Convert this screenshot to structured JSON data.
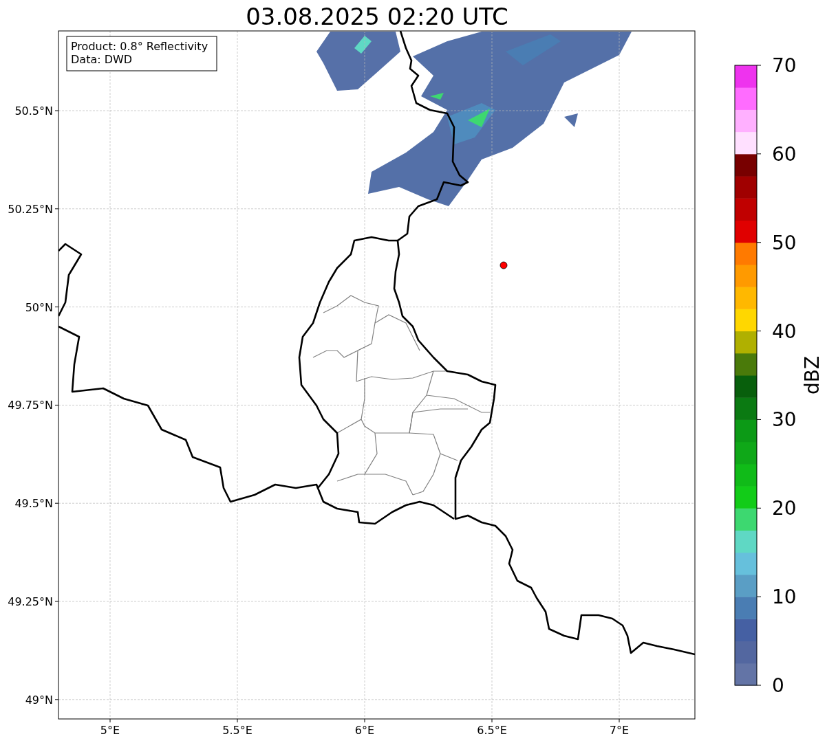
{
  "title": "03.08.2025 02:20 UTC",
  "info_box": [
    "Product: 0.8° Reflectivity",
    "Data: DWD"
  ],
  "y_ticks": [
    "50.5°N",
    "50.25°N",
    "50°N",
    "49.75°N",
    "49.5°N",
    "49.25°N",
    "49°N"
  ],
  "x_ticks": [
    "5°E",
    "5.5°E",
    "6°E",
    "6.5°E",
    "7°E"
  ],
  "colorbar": {
    "label": "dBZ",
    "ticks": [
      "70",
      "60",
      "50",
      "40",
      "30",
      "20",
      "10",
      "0"
    ],
    "bins": [
      {
        "color": "#6374a6"
      },
      {
        "color": "#5367a0"
      },
      {
        "color": "#4560a3"
      },
      {
        "color": "#4a7db3"
      },
      {
        "color": "#5a9ec5"
      },
      {
        "color": "#66c0dc"
      },
      {
        "color": "#5fd8c4"
      },
      {
        "color": "#3dd870"
      },
      {
        "color": "#12cc18"
      },
      {
        "color": "#10bb18"
      },
      {
        "color": "#0fa818"
      },
      {
        "color": "#0c9a16"
      },
      {
        "color": "#0b7a12"
      },
      {
        "color": "#085f0c"
      },
      {
        "color": "#4a7a0a"
      },
      {
        "color": "#b0b000"
      },
      {
        "color": "#ffd700"
      },
      {
        "color": "#ffb800"
      },
      {
        "color": "#ff9a00"
      },
      {
        "color": "#ff7a00"
      },
      {
        "color": "#e00000"
      },
      {
        "color": "#c00000"
      },
      {
        "color": "#a00000"
      },
      {
        "color": "#780000"
      },
      {
        "color": "#ffe0ff"
      },
      {
        "color": "#ffb0ff"
      },
      {
        "color": "#ff6cff"
      },
      {
        "color": "#ee33ee"
      }
    ]
  }
}
